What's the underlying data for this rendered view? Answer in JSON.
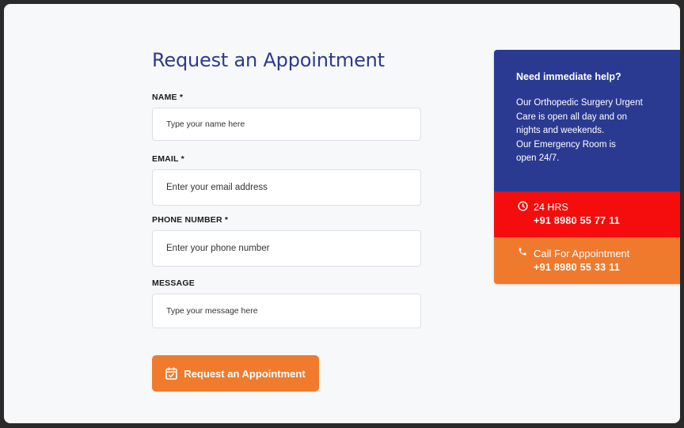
{
  "form": {
    "title": "Request an Appointment",
    "name_label": "NAME *",
    "name_placeholder": "Type your name here",
    "email_label": "EMAIL *",
    "email_placeholder": "Enter your email address",
    "phone_label": "PHONE NUMBER *",
    "phone_placeholder": "Enter your phone number",
    "message_label": "MESSAGE",
    "message_placeholder": "Type your message here",
    "submit_label": "Request an Appointment",
    "submit_icon": "calendar-check-icon"
  },
  "help": {
    "heading": "Need immediate help?",
    "lines": [
      "Our Orthopedic Surgery Urgent",
      "Care is open all day and on",
      "nights and weekends.",
      "Our Emergency Room is",
      "open 24/7."
    ],
    "emergency": {
      "icon": "clock-icon",
      "title": "24 HRS",
      "phone": "+91 8980 55 77 11"
    },
    "appointment": {
      "icon": "phone-icon",
      "title": "Call For Appointment",
      "phone": "+91 8980 55 33 11"
    }
  },
  "colors": {
    "title": "#2d3a8c",
    "button": "#f07b2d",
    "panel_blue": "#2b3a91",
    "panel_red": "#f50d0d",
    "panel_orange": "#ef7a2e"
  }
}
